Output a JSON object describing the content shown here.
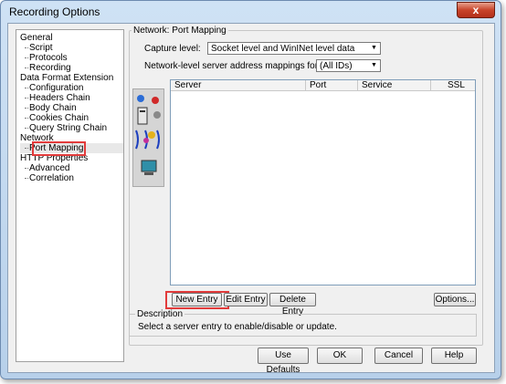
{
  "window": {
    "title": "Recording Options",
    "close_label": "x"
  },
  "tree": {
    "items": [
      {
        "label": "General",
        "level": 0
      },
      {
        "label": "Script",
        "level": 1
      },
      {
        "label": "Protocols",
        "level": 1
      },
      {
        "label": "Recording",
        "level": 1
      },
      {
        "label": "Data Format Extension",
        "level": 0
      },
      {
        "label": "Configuration",
        "level": 1
      },
      {
        "label": "Headers Chain",
        "level": 1
      },
      {
        "label": "Body Chain",
        "level": 1
      },
      {
        "label": "Cookies Chain",
        "level": 1
      },
      {
        "label": "Query String Chain",
        "level": 1
      },
      {
        "label": "Network",
        "level": 0
      },
      {
        "label": "Port Mapping",
        "level": 1,
        "selected": true
      },
      {
        "label": "HTTP Properties",
        "level": 0
      },
      {
        "label": "Advanced",
        "level": 1
      },
      {
        "label": "Correlation",
        "level": 1
      }
    ]
  },
  "panel": {
    "group_title": "Network: Port Mapping",
    "capture_label": "Capture level:",
    "capture_value": "Socket level and WinINet level data",
    "mapping_label": "Network-level server address mappings for :",
    "mapping_value": "(All IDs)"
  },
  "table": {
    "columns": [
      "Server",
      "Port",
      "Service",
      "SSL"
    ],
    "rows": []
  },
  "buttons": {
    "new_entry": "New Entry",
    "edit_entry": "Edit Entry",
    "delete_entry": "Delete Entry",
    "options": "Options..."
  },
  "description": {
    "label": "Description",
    "text": "Select a server entry to enable/disable or update."
  },
  "footer": {
    "use_defaults": "Use Defaults",
    "ok": "OK",
    "cancel": "Cancel",
    "help": "Help"
  },
  "colors": {
    "highlight": "#e23b3b"
  }
}
